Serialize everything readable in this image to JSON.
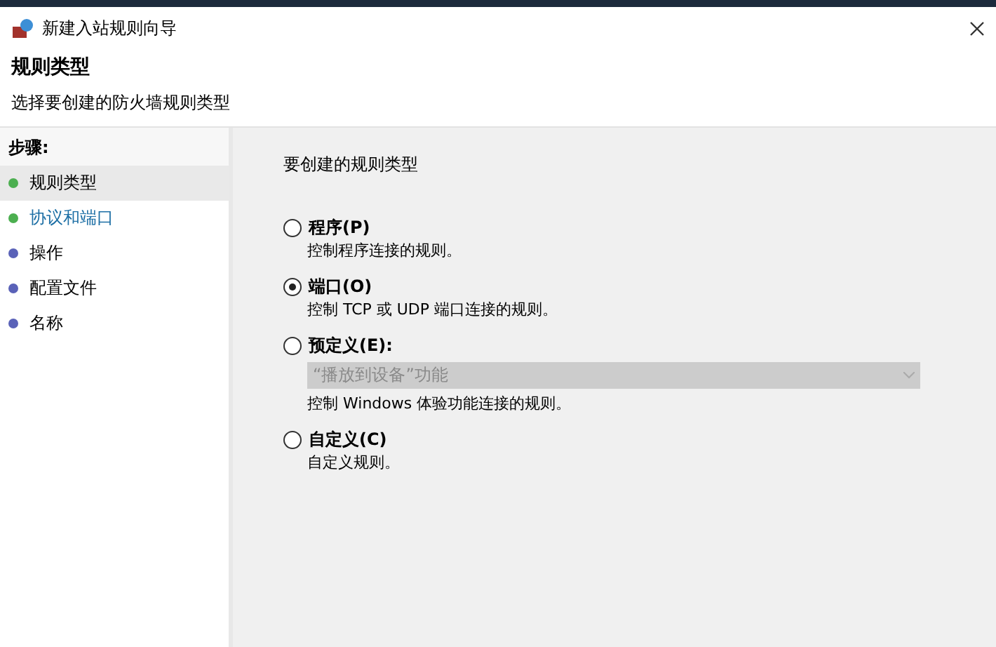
{
  "window": {
    "title": "新建入站规则向导"
  },
  "header": {
    "title": "规则类型",
    "subtitle": "选择要创建的防火墙规则类型"
  },
  "steps": {
    "heading": "步骤:",
    "items": [
      {
        "label": "规则类型",
        "color": "#4caf50",
        "selected": true,
        "hovered": false
      },
      {
        "label": "协议和端口",
        "color": "#4caf50",
        "selected": false,
        "hovered": true
      },
      {
        "label": "操作",
        "color": "#5a62b8",
        "selected": false,
        "hovered": false
      },
      {
        "label": "配置文件",
        "color": "#5a62b8",
        "selected": false,
        "hovered": false
      },
      {
        "label": "名称",
        "color": "#5a62b8",
        "selected": false,
        "hovered": false
      }
    ]
  },
  "content": {
    "prompt": "要创建的规则类型",
    "options": [
      {
        "label": "程序(P)",
        "description": "控制程序连接的规则。",
        "selected": false
      },
      {
        "label": "端口(O)",
        "description": "控制 TCP 或 UDP 端口连接的规则。",
        "selected": true
      },
      {
        "label": "预定义(E):",
        "dropdown": {
          "value": "“播放到设备”功能",
          "disabled": true
        },
        "description": "控制 Windows 体验功能连接的规则。",
        "selected": false
      },
      {
        "label": "自定义(C)",
        "description": "自定义规则。",
        "selected": false
      }
    ]
  }
}
